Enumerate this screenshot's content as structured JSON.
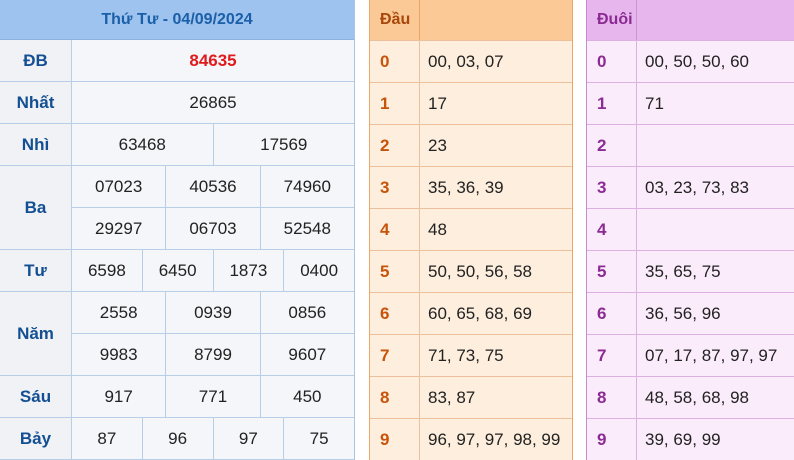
{
  "results": {
    "title": "Thứ Tư - 04/09/2024",
    "rows": [
      {
        "label": "ĐB",
        "lines": [
          [
            "84635"
          ]
        ]
      },
      {
        "label": "Nhất",
        "lines": [
          [
            "26865"
          ]
        ]
      },
      {
        "label": "Nhì",
        "lines": [
          [
            "63468",
            "17569"
          ]
        ]
      },
      {
        "label": "Ba",
        "lines": [
          [
            "07023",
            "40536",
            "74960"
          ],
          [
            "29297",
            "06703",
            "52548"
          ]
        ]
      },
      {
        "label": "Tư",
        "lines": [
          [
            "6598",
            "6450",
            "1873",
            "0400"
          ]
        ]
      },
      {
        "label": "Năm",
        "lines": [
          [
            "2558",
            "0939",
            "0856"
          ],
          [
            "9983",
            "8799",
            "9607"
          ]
        ]
      },
      {
        "label": "Sáu",
        "lines": [
          [
            "917",
            "771",
            "450"
          ]
        ]
      },
      {
        "label": "Bảy",
        "lines": [
          [
            "87",
            "96",
            "97",
            "75"
          ]
        ]
      }
    ]
  },
  "dau": {
    "title": "Đầu",
    "rows": [
      {
        "key": "0",
        "value": "00, 03, 07"
      },
      {
        "key": "1",
        "value": "17"
      },
      {
        "key": "2",
        "value": "23"
      },
      {
        "key": "3",
        "value": "35, 36, 39"
      },
      {
        "key": "4",
        "value": "48"
      },
      {
        "key": "5",
        "value": "50, 50, 56, 58"
      },
      {
        "key": "6",
        "value": "60, 65, 68, 69"
      },
      {
        "key": "7",
        "value": "71, 73, 75"
      },
      {
        "key": "8",
        "value": "83, 87"
      },
      {
        "key": "9",
        "value": "96, 97, 97, 98, 99"
      }
    ]
  },
  "duoi": {
    "title": "Đuôi",
    "rows": [
      {
        "key": "0",
        "value": "00, 50, 50, 60"
      },
      {
        "key": "1",
        "value": "71"
      },
      {
        "key": "2",
        "value": ""
      },
      {
        "key": "3",
        "value": "03, 23, 73, 83"
      },
      {
        "key": "4",
        "value": ""
      },
      {
        "key": "5",
        "value": "35, 65, 75"
      },
      {
        "key": "6",
        "value": "36, 56, 96"
      },
      {
        "key": "7",
        "value": "07, 17, 87, 97, 97"
      },
      {
        "key": "8",
        "value": "48, 58, 68, 98"
      },
      {
        "key": "9",
        "value": "39, 69, 99"
      }
    ]
  },
  "colors": {
    "special_number": "#e01b1b",
    "results_header": "#9ec3ef",
    "dau_header": "#fbc996",
    "duoi_header": "#e6b6ec"
  }
}
